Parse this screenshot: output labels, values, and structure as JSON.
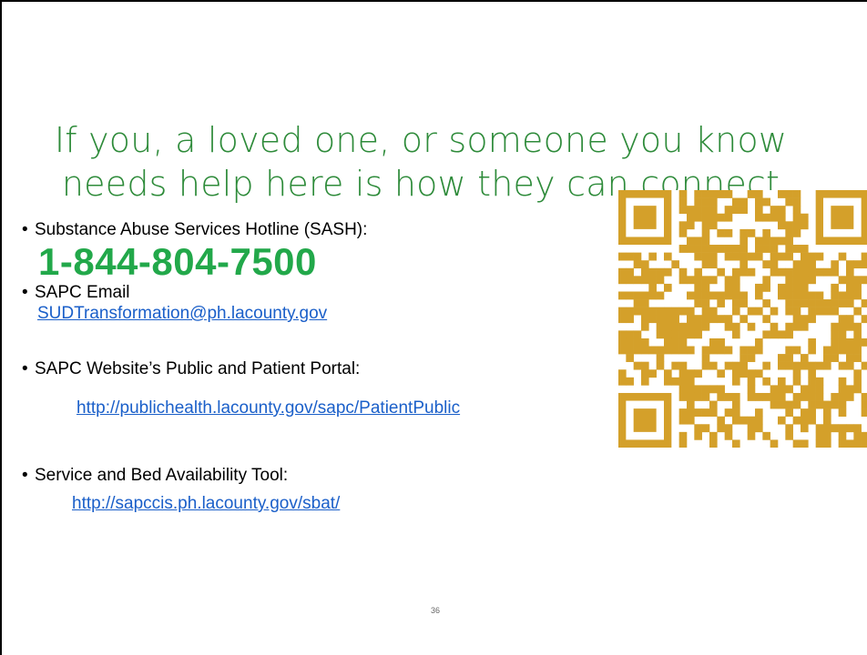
{
  "slide": {
    "title_lines": [
      "If you, a loved one, or someone you know",
      "needs help here is how they can connect"
    ],
    "bullets": {
      "hotline_label": "Substance Abuse Services Hotline (SASH):",
      "hotline_number": "1-844-804-7500",
      "email_label": "SAPC Email",
      "email_link": "SUDTransformation@ph.lacounty.gov",
      "portal_label": "SAPC Website’s Public and Patient Portal:",
      "portal_link": "http://publichealth.lacounty.gov/sapc/PatientPublic",
      "sbat_label": "Service and Bed Availability Tool:",
      "sbat_link": "http://sapccis.ph.lacounty.gov/sbat/"
    },
    "bullet_char": "•",
    "page_number": "36"
  },
  "colors": {
    "title": "#2e8b3a",
    "phone": "#22a84a",
    "link": "#1a5fc9",
    "qr": "#d4a02a"
  },
  "icons": {
    "qr": "qr-code-icon"
  }
}
